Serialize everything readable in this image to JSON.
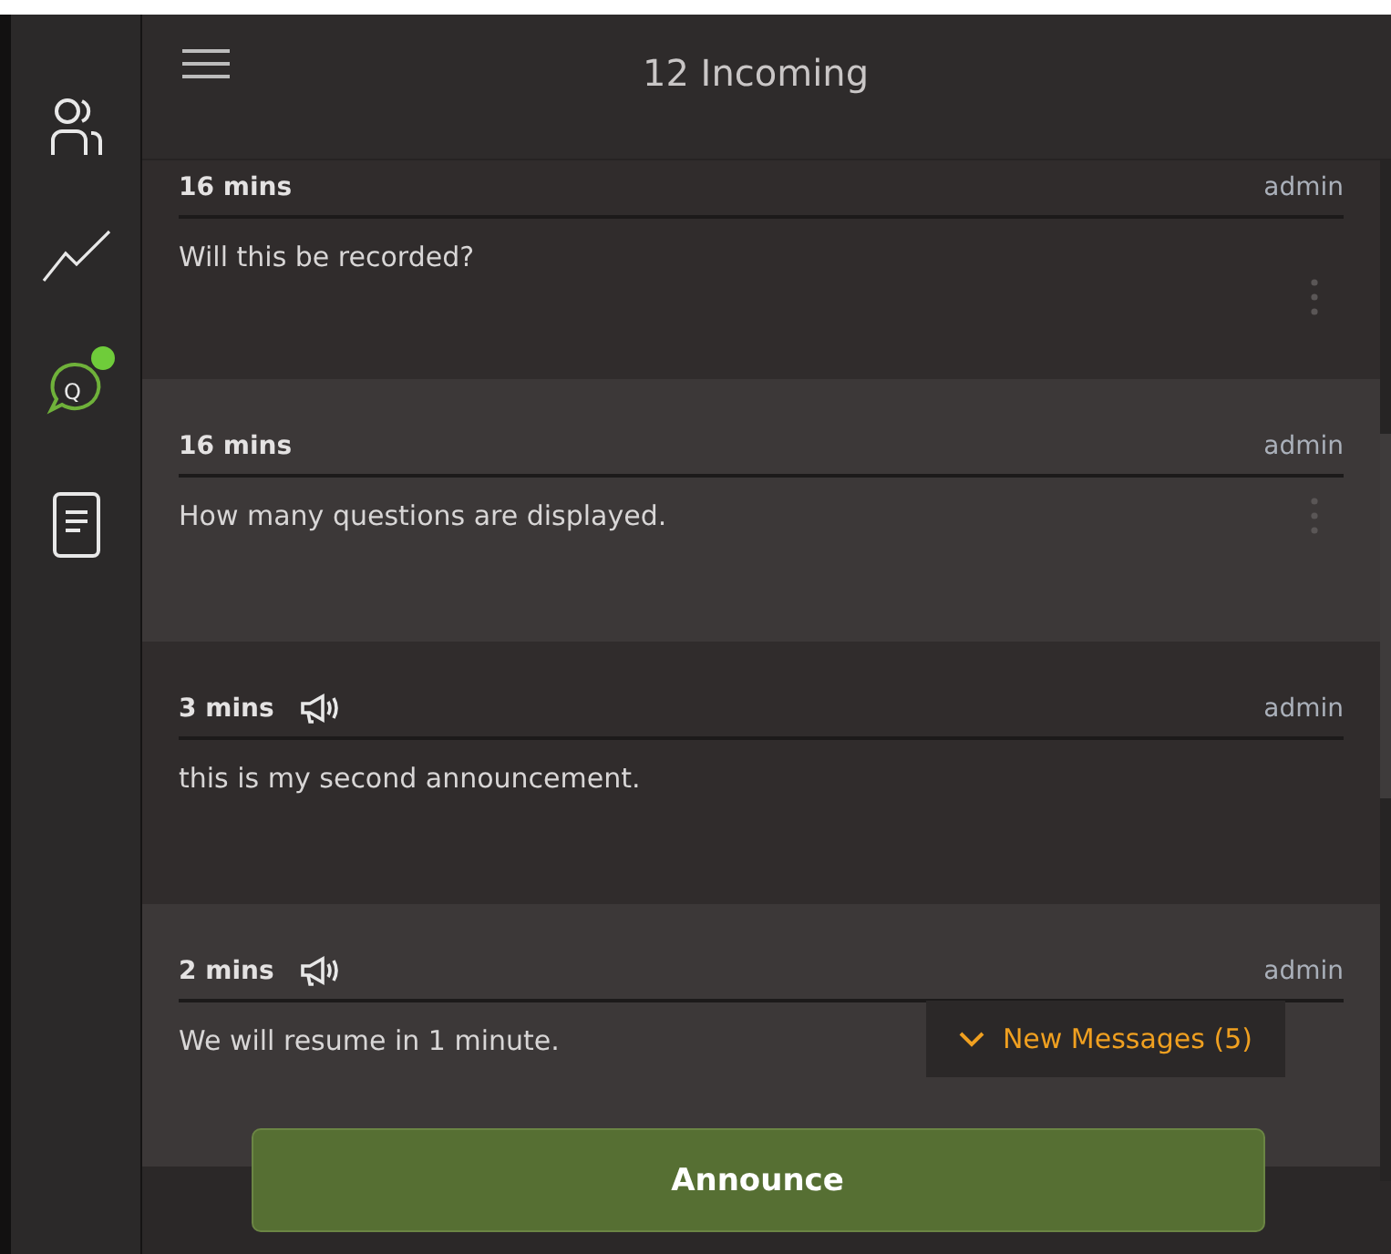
{
  "sidebar": {
    "items": [
      {
        "selected": false,
        "unread": false
      },
      {
        "selected": false,
        "unread": false
      },
      {
        "selected": true,
        "unread": true,
        "icon_text": "Q"
      },
      {
        "selected": false,
        "unread": false
      }
    ]
  },
  "header": {
    "title": "12 Incoming"
  },
  "messages": [
    {
      "kind": "question",
      "time": "16 mins",
      "author": "admin",
      "text": "Will this be recorded?"
    },
    {
      "kind": "question",
      "time": "16 mins",
      "author": "admin",
      "text": "How many questions are displayed."
    },
    {
      "kind": "announcement",
      "time": "3 mins",
      "author": "admin",
      "text": "this is my second announcement."
    },
    {
      "kind": "announcement",
      "time": "2 mins",
      "author": "admin",
      "text": "We will resume in 1 minute."
    }
  ],
  "new_messages": {
    "label": "New Messages (5)"
  },
  "announce_button": {
    "label": "Announce"
  }
}
